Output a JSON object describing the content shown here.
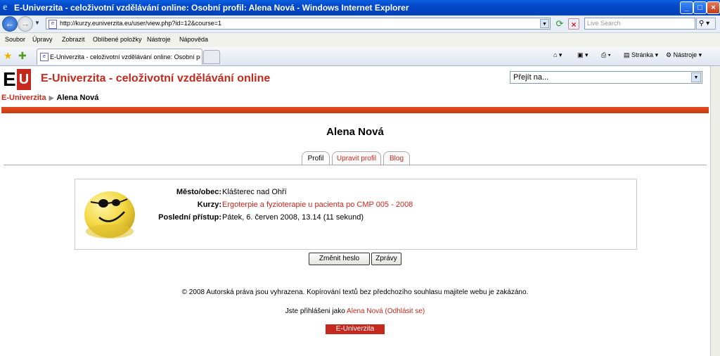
{
  "window": {
    "title": "E-Univerzita - celoživotní vzdělávání online: Osobní profil: Alena Nová - Windows Internet Explorer"
  },
  "browser": {
    "url": "http://kurzy.euniverzita.eu/user/view.php?id=12&course=1",
    "search_placeholder": "Live Search",
    "menu": [
      "Soubor",
      "Úpravy",
      "Zobrazit",
      "Oblíbené položky",
      "Nástroje",
      "Nápověda"
    ],
    "tab_title": "E-Univerzita - celoživotní vzdělávání online: Osobní pr...",
    "page_label": "Stránka",
    "tools_label": "Nástroje"
  },
  "site": {
    "logo_e": "E",
    "logo_u": "U",
    "title": "E-Univerzita - celoživotní vzdělávání online",
    "jump_label": "Přejít na...",
    "accent_color": "#c5281c"
  },
  "breadcrumb": {
    "home": "E-Univerzita",
    "separator": "▶",
    "current": "Alena Nová"
  },
  "profile": {
    "name": "Alena Nová",
    "tabs": [
      {
        "label": "Profil"
      },
      {
        "label": "Upravit profil"
      },
      {
        "label": "Blog"
      }
    ],
    "fields": [
      {
        "label": "Město/obec:",
        "value": "Klášterec nad Ohří"
      },
      {
        "label": "Kurzy:",
        "value": "Ergoterpie a fyzioterapie u pacienta po CMP 005 - 2008"
      },
      {
        "label": "Poslední přístup:",
        "value": "Pátek, 6. červen 2008, 13.14  (11 sekund)"
      }
    ],
    "buttons": {
      "change_password": "Změnit heslo",
      "messages": "Zprávy"
    }
  },
  "footer": {
    "copyright": "© 2008 Autorská práva jsou vyhrazena. Kopírování textů bez předchozího souhlasu majitele webu je zakázáno.",
    "login_prefix": "Jste přihlášeni jako ",
    "login_user": "Alena Nová",
    "logout_open": " (",
    "logout": "Odhlásit se",
    "logout_close": ")",
    "home_button": "E-Univerzita"
  }
}
